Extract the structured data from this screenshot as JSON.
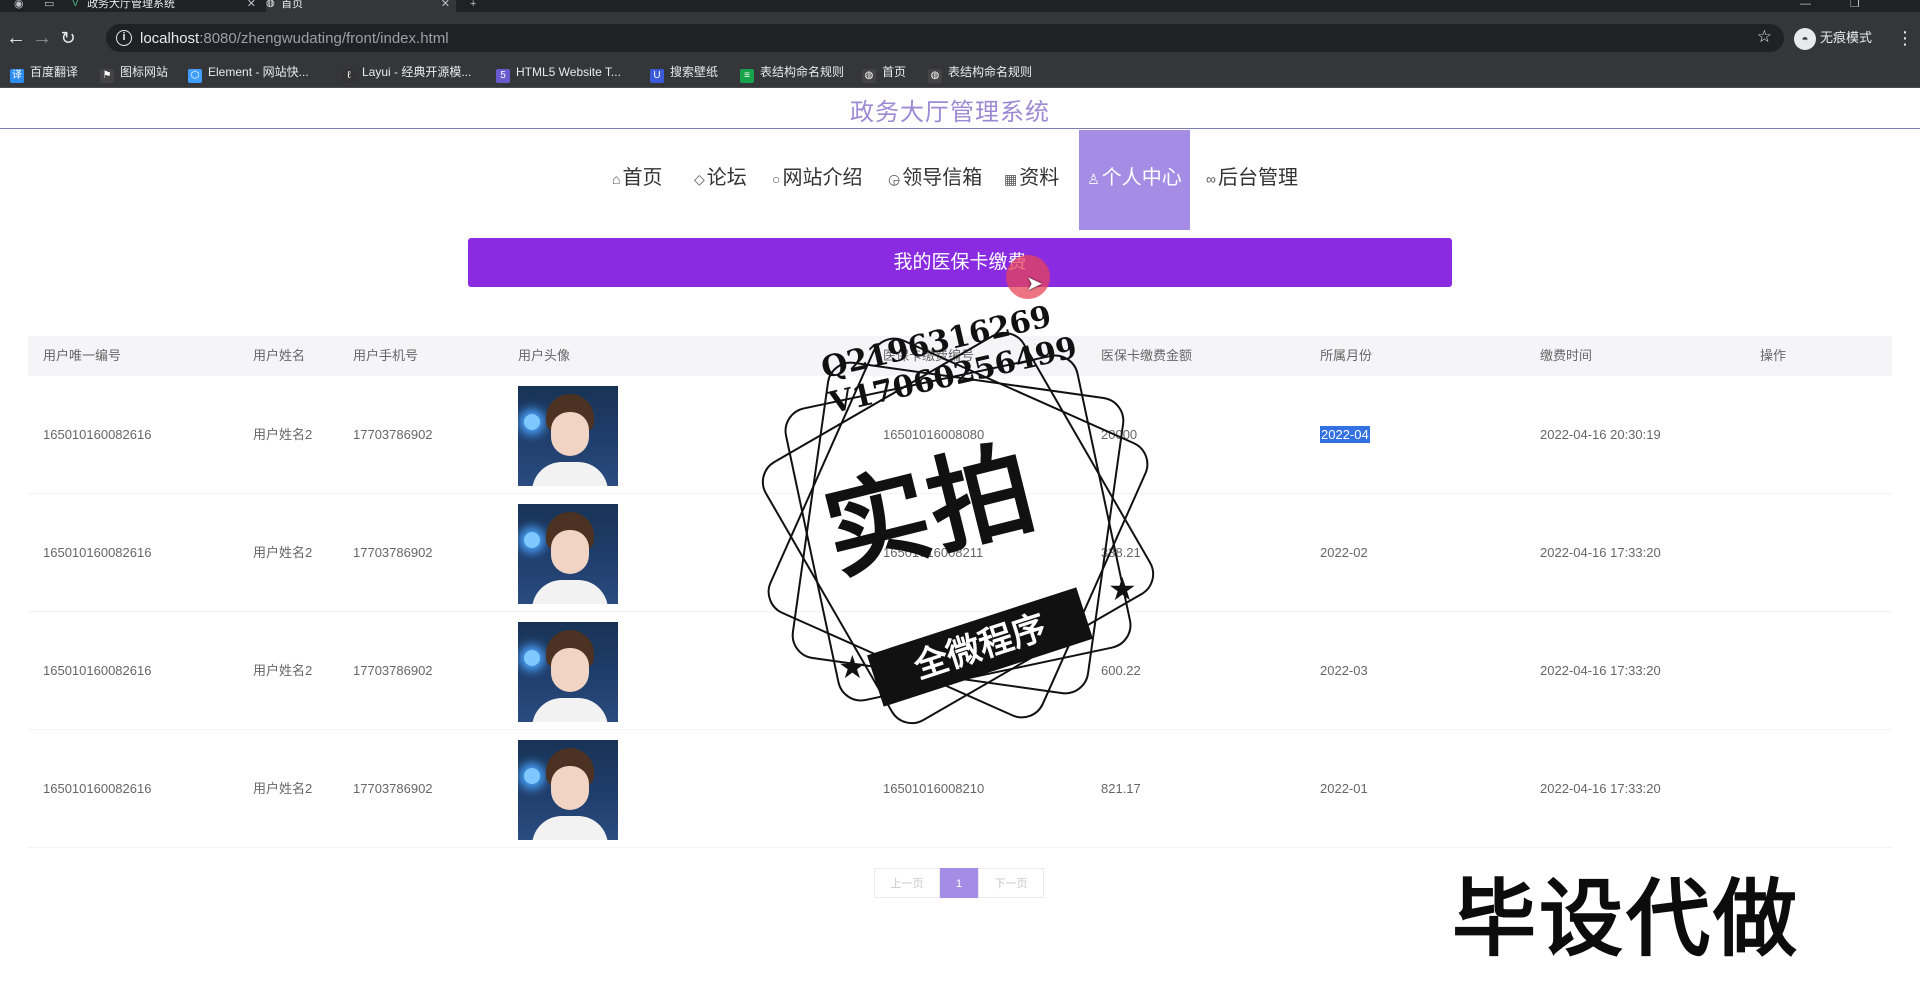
{
  "browser": {
    "tabs": [
      {
        "icon": "vue-icon",
        "title": "政务大厅管理系统",
        "active": false
      },
      {
        "icon": "globe-icon",
        "title": "首页",
        "active": true
      }
    ],
    "new_tab": "+",
    "url_host": "localhost",
    "url_path": ":8080/zhengwudating/front/index.html",
    "incognito_label": "无痕模式",
    "bookmarks": [
      {
        "icon": "translate-icon",
        "label": "百度翻译",
        "color": "#2d8cf0"
      },
      {
        "icon": "flag-icon",
        "label": "图标网站",
        "color": "#444444"
      },
      {
        "icon": "element-icon",
        "label": "Element - 网站快...",
        "color": "#409eff"
      },
      {
        "icon": "layui-icon",
        "label": "Layui - 经典开源模...",
        "color": "#333333"
      },
      {
        "icon": "html5-icon",
        "label": "HTML5 Website T...",
        "color": "#6a5acd"
      },
      {
        "icon": "wallpaper-icon",
        "label": "搜索壁纸",
        "color": "#3b5bdb"
      },
      {
        "icon": "sheet-icon",
        "label": "表结构命名规则",
        "color": "#16a34a"
      },
      {
        "icon": "globe-icon",
        "label": "首页",
        "color": "#444444"
      },
      {
        "icon": "globe-icon",
        "label": "表结构命名规则",
        "color": "#444444"
      }
    ]
  },
  "site": {
    "title": "政务大厅管理系统",
    "nav": [
      {
        "icon": "home-icon",
        "glyph": "⌂",
        "label": "首页",
        "active": false
      },
      {
        "icon": "tag-icon",
        "glyph": "◇",
        "label": "论坛",
        "active": false
      },
      {
        "icon": "circle-icon",
        "glyph": "○",
        "label": "网站介绍",
        "active": false
      },
      {
        "icon": "compass-icon",
        "glyph": "◶",
        "label": "领导信箱",
        "active": false
      },
      {
        "icon": "calendar-icon",
        "glyph": "▦",
        "label": "资料",
        "active": false
      },
      {
        "icon": "user-icon",
        "glyph": "♙",
        "label": "个人中心",
        "active": true
      },
      {
        "icon": "link-icon",
        "glyph": "∞",
        "label": "后台管理",
        "active": false
      }
    ],
    "accent": "#a58de6",
    "banner_color": "#8a2be2"
  },
  "page": {
    "banner": "我的医保卡缴费",
    "columns": [
      "用户唯一编号",
      "用户姓名",
      "用户手机号",
      "用户头像",
      "医保卡缴费编号",
      "医保卡缴费金额",
      "所属月份",
      "缴费时间",
      "操作"
    ],
    "rows": [
      {
        "uid": "165010160082616",
        "name": "用户姓名2",
        "phone": "17703786902",
        "avatar": "avatar-photo",
        "pay_no": "16501016008080",
        "amount": "20000",
        "month": "2022-04",
        "time": "2022-04-16 20:30:19",
        "selected_month": true
      },
      {
        "uid": "165010160082616",
        "name": "用户姓名2",
        "phone": "17703786902",
        "avatar": "avatar-photo",
        "pay_no": "16501016008211",
        "amount": "338.21",
        "month": "2022-02",
        "time": "2022-04-16 17:33:20",
        "selected_month": false
      },
      {
        "uid": "165010160082616",
        "name": "用户姓名2",
        "phone": "17703786902",
        "avatar": "avatar-photo",
        "pay_no": "16501016008118",
        "amount": "600.22",
        "month": "2022-03",
        "time": "2022-04-16 17:33:20",
        "selected_month": false
      },
      {
        "uid": "165010160082616",
        "name": "用户姓名2",
        "phone": "17703786902",
        "avatar": "avatar-photo",
        "pay_no": "16501016008210",
        "amount": "821.17",
        "month": "2022-01",
        "time": "2022-04-16 17:33:20",
        "selected_month": false
      }
    ],
    "pager": {
      "prev": "上一页",
      "current": "1",
      "next": "下一页"
    }
  },
  "watermark": {
    "contact_q": "Q2196316269",
    "contact_v": "V17060256499",
    "big": "实拍",
    "ribbon": "全微程序",
    "corner": "毕设代做"
  }
}
